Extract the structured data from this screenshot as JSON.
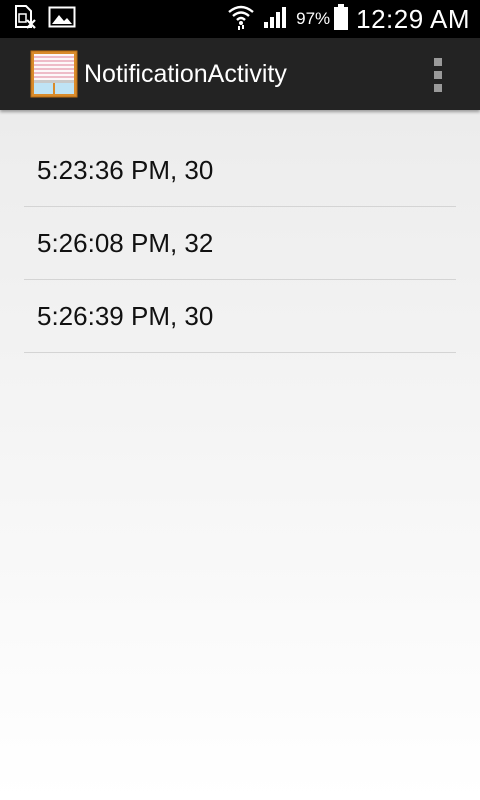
{
  "status_bar": {
    "left_icons": [
      "sim-error-icon",
      "gallery-icon"
    ],
    "right_icons": [
      "wifi-icon",
      "signal-icon",
      "battery-icon"
    ],
    "battery_percent": "97%",
    "time": "12:29 AM"
  },
  "action_bar": {
    "title": "NotificationActivity",
    "app_icon": "window-blinds-icon",
    "overflow_icon": "overflow-menu-icon"
  },
  "list": {
    "items": [
      {
        "label": "5:23:36 PM, 30"
      },
      {
        "label": "5:26:08 PM, 32"
      },
      {
        "label": "5:26:39 PM, 30"
      }
    ]
  },
  "colors": {
    "status_bar": "#000000",
    "action_bar": "#232323",
    "divider": "#d4d4d4",
    "text": "#111111"
  }
}
